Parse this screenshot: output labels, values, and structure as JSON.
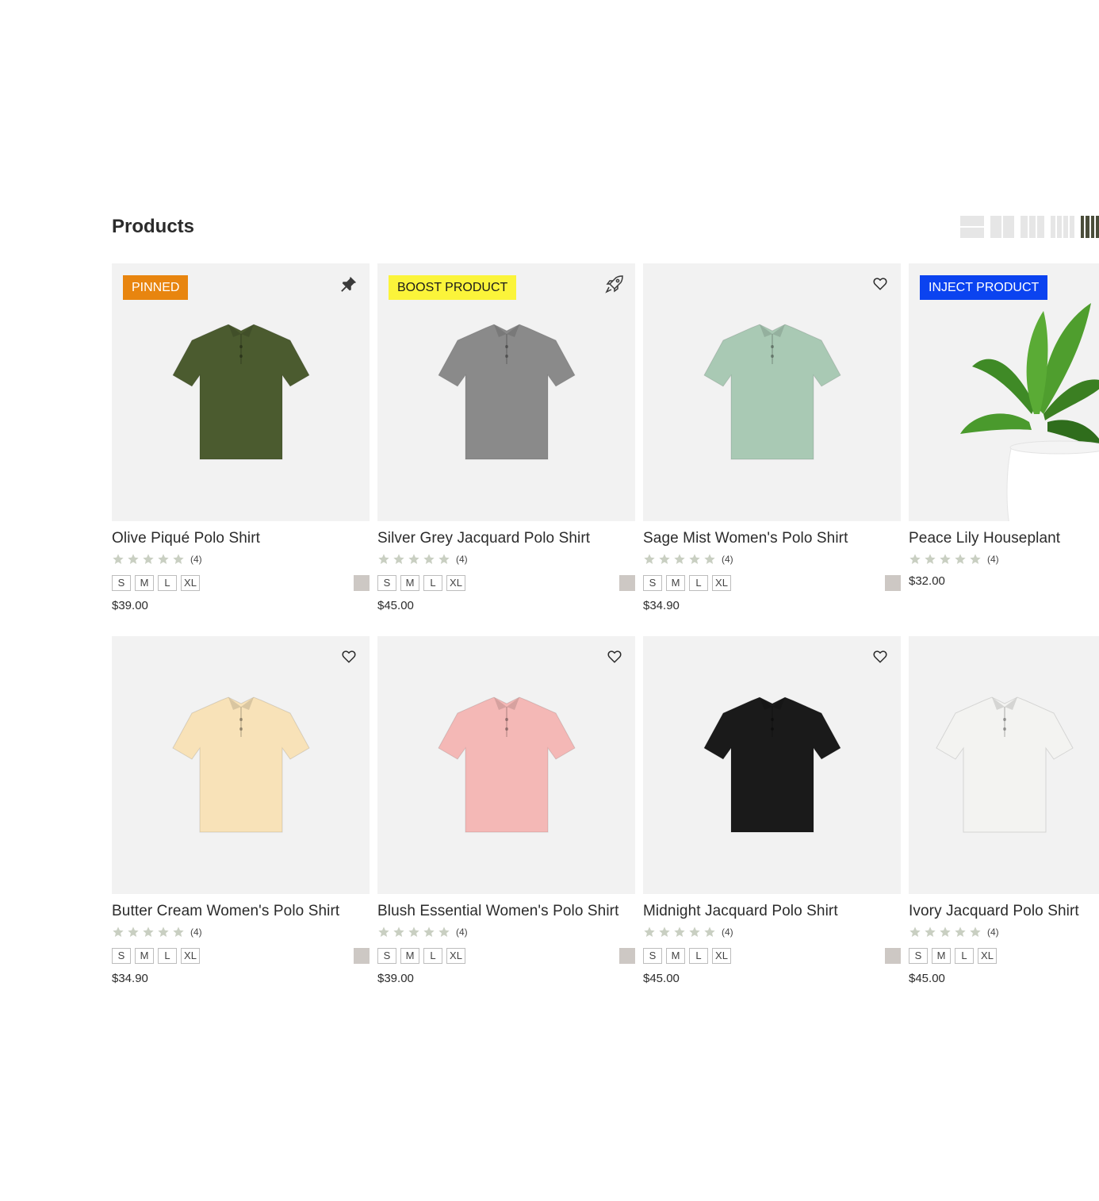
{
  "page": {
    "title": "Products"
  },
  "layout_options": [
    {
      "name": "layout-1-col",
      "active": false
    },
    {
      "name": "layout-2-col",
      "active": false
    },
    {
      "name": "layout-3-col",
      "active": false
    },
    {
      "name": "layout-4-col",
      "active": false
    },
    {
      "name": "layout-5-col",
      "active": true
    }
  ],
  "products": [
    {
      "name": "Olive Piqué Polo Shirt",
      "badge": "PINNED",
      "corner_icon": "pin-icon",
      "color": "#4b5b2f",
      "rating_count": "(4)",
      "sizes": [
        "S",
        "M",
        "L",
        "XL"
      ],
      "price": "$39.00"
    },
    {
      "name": "Silver Grey Jacquard Polo Shirt",
      "badge": "BOOST PRODUCT",
      "corner_icon": "rocket-icon",
      "color": "#8a8a8a",
      "rating_count": "(4)",
      "sizes": [
        "S",
        "M",
        "L",
        "XL"
      ],
      "price": "$45.00"
    },
    {
      "name": "Sage Mist Women's Polo Shirt",
      "badge": "",
      "corner_icon": "heart-icon",
      "color": "#a9c9b4",
      "rating_count": "(4)",
      "sizes": [
        "S",
        "M",
        "L",
        "XL"
      ],
      "price": "$34.90"
    },
    {
      "name": "Peace Lily Houseplant",
      "badge": "INJECT PRODUCT",
      "corner_icon": "",
      "color": "#3f8a26",
      "rating_count": "(4)",
      "sizes": [],
      "price": "$32.00"
    },
    {
      "name": "Butter Cream Women's Polo Shirt",
      "badge": "",
      "corner_icon": "heart-icon",
      "color": "#f8e2b8",
      "rating_count": "(4)",
      "sizes": [
        "S",
        "M",
        "L",
        "XL"
      ],
      "price": "$34.90"
    },
    {
      "name": "Blush Essential Women's Polo Shirt",
      "badge": "",
      "corner_icon": "heart-icon",
      "color": "#f4b8b6",
      "rating_count": "(4)",
      "sizes": [
        "S",
        "M",
        "L",
        "XL"
      ],
      "price": "$39.00"
    },
    {
      "name": "Midnight Jacquard Polo Shirt",
      "badge": "",
      "corner_icon": "heart-icon",
      "color": "#1a1a1a",
      "rating_count": "(4)",
      "sizes": [
        "S",
        "M",
        "L",
        "XL"
      ],
      "price": "$45.00"
    },
    {
      "name": "Ivory Jacquard Polo Shirt",
      "badge": "",
      "corner_icon": "",
      "color": "#f3f3f1",
      "rating_count": "(4)",
      "sizes": [
        "S",
        "M",
        "L",
        "XL"
      ],
      "price": "$45.00"
    }
  ],
  "colors": {
    "star": "#c9cfc2",
    "swatch": "#cdc8c4",
    "pinned_badge": "#e8850f",
    "boost_badge": "#fbf43a",
    "inject_badge": "#0b43f0"
  }
}
